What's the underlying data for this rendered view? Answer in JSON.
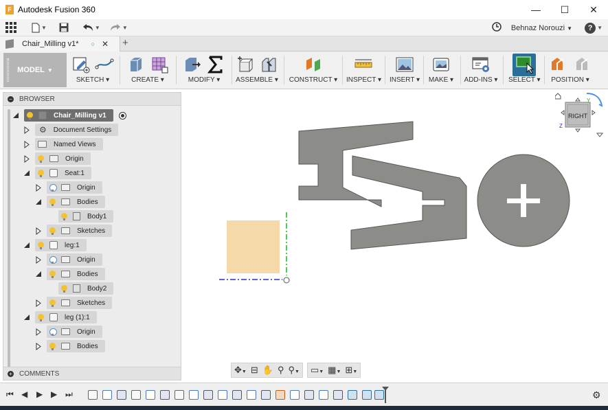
{
  "window": {
    "app_icon": "F",
    "title": "Autodesk Fusion 360",
    "minimize": "—",
    "maximize": "☐",
    "close": "✕"
  },
  "quick_access": {
    "grid_icon": "grid-icon",
    "file_icon": "file-icon",
    "save_icon": "save-icon",
    "undo_icon": "undo-icon",
    "redo_icon": "redo-icon",
    "user_name": "Behnaz Norouzi",
    "help": "?"
  },
  "document_tab": {
    "name": "Chair_Milling v1*",
    "status": "○",
    "close": "✕",
    "new_tab": "+"
  },
  "toolbar": {
    "workspace": "MODEL",
    "groups": [
      "SKETCH",
      "CREATE",
      "MODIFY",
      "ASSEMBLE",
      "CONSTRUCT",
      "INSPECT",
      "INSERT",
      "MAKE",
      "ADD-INS",
      "SELECT",
      "POSITION"
    ]
  },
  "browser": {
    "title": "BROWSER",
    "root": "Chair_Milling v1",
    "items": {
      "document_settings": "Document Settings",
      "named_views": "Named Views",
      "origin_root": "Origin",
      "seat": "Seat:1",
      "seat_origin": "Origin",
      "seat_bodies": "Bodies",
      "body1": "Body1",
      "seat_sketches": "Sketches",
      "leg": "leg:1",
      "leg_origin": "Origin",
      "leg_bodies": "Bodies",
      "body2": "Body2",
      "leg_sketches": "Sketches",
      "leg2": "leg (1):1",
      "leg2_origin": "Origin",
      "leg2_bodies": "Bodies"
    }
  },
  "comments": {
    "title": "COMMENTS"
  },
  "viewcube": {
    "face": "RIGHT",
    "axis_y": "Y",
    "axis_z": "Z"
  },
  "colors": {
    "part_fill": "#8c8c88",
    "sketch_fill": "#f5d9a8",
    "axis_green": "#1db81d",
    "axis_blue": "#2a2ad0",
    "select_active": "#2a6e9a"
  }
}
